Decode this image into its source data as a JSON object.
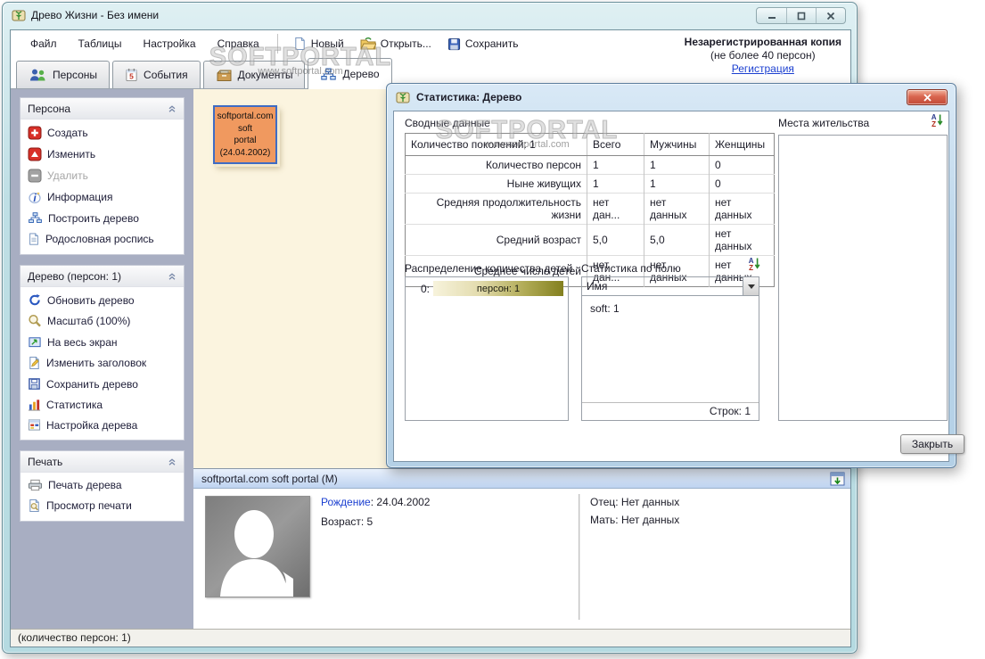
{
  "window": {
    "title": "Древо Жизни - Без имени"
  },
  "menu": {
    "items": [
      "Файл",
      "Таблицы",
      "Настройка",
      "Справка"
    ]
  },
  "toolbar": {
    "new_label": "Новый",
    "open_label": "Открыть...",
    "save_label": "Сохранить"
  },
  "registration": {
    "line1": "Незарегистрированная копия",
    "line2": "(не более 40 персон)",
    "link": "Регистрация"
  },
  "tabs": [
    {
      "label": "Персоны"
    },
    {
      "label": "События"
    },
    {
      "label": "Документы"
    },
    {
      "label": "Дерево"
    }
  ],
  "sidebar": {
    "groups": [
      {
        "title": "Персона",
        "items": [
          {
            "label": "Создать"
          },
          {
            "label": "Изменить"
          },
          {
            "label": "Удалить"
          },
          {
            "label": "Информация"
          },
          {
            "label": "Построить дерево"
          },
          {
            "label": "Родословная роспись"
          }
        ]
      },
      {
        "title": "Дерево (персон: 1)",
        "items": [
          {
            "label": "Обновить дерево"
          },
          {
            "label": "Масштаб (100%)"
          },
          {
            "label": "На весь экран"
          },
          {
            "label": "Изменить заголовок"
          },
          {
            "label": "Сохранить дерево"
          },
          {
            "label": "Статистика"
          },
          {
            "label": "Настройка дерева"
          }
        ]
      },
      {
        "title": "Печать",
        "items": [
          {
            "label": "Печать дерева"
          },
          {
            "label": "Просмотр печати"
          }
        ]
      }
    ]
  },
  "canvas": {
    "node_lines": [
      "softportal.com",
      "soft",
      "portal",
      "(24.04.2002)"
    ]
  },
  "dialog": {
    "title": "Статистика: Дерево",
    "summary_label": "Сводные данные",
    "table": {
      "header": [
        "Количество поколений: 1",
        "Всего",
        "Мужчины",
        "Женщины"
      ],
      "rows": [
        [
          "Количество персон",
          "1",
          "1",
          "0"
        ],
        [
          "Ныне живущих",
          "1",
          "1",
          "0"
        ],
        [
          "Средняя продолжительность жизни",
          "нет дан...",
          "нет данных",
          "нет данных"
        ],
        [
          "Средний возраст",
          "5,0",
          "5,0",
          "нет данных"
        ],
        [
          "Среднее число детей",
          "нет дан...",
          "нет данных",
          "нет данных"
        ]
      ]
    },
    "children_dist": {
      "label": "Распределение количества детей",
      "row_key": "0:",
      "bar_text": "персон: 1"
    },
    "field_stats": {
      "label": "Статистика по полю",
      "dropdown_value": "Имя",
      "list_item": "soft: 1",
      "rows_label": "Строк: 1"
    },
    "places": {
      "label": "Места жительства"
    },
    "close_button": "Закрыть"
  },
  "person_panel": {
    "header": "softportal.com soft portal (М)",
    "birth_label": "Рождение",
    "birth_value": ": 24.04.2002",
    "age": "Возраст: 5",
    "father": "Отец: Нет данных",
    "mother": "Мать: Нет данных"
  },
  "statusbar": {
    "text": "(количество персон: 1)"
  },
  "watermark": {
    "big": "SOFTPORTAL",
    "small": "www.softportal.com"
  },
  "icons": {
    "app": "scroll-with-green-tree",
    "sort": "A-Z-letters-green-down-arrow",
    "panel_collapse": "panel-with-green-down-arrow"
  },
  "colors": {
    "frame": "#bfdfe5",
    "sidebar_bg": "#a8aec2",
    "canvas_bg": "#fbf4df",
    "node_fill": "#f0995f",
    "node_border": "#3e6cc4",
    "link_blue": "#1b3fd0",
    "bar_gradient_end": "#83801f",
    "dialog_close_red": "#c24a36"
  }
}
